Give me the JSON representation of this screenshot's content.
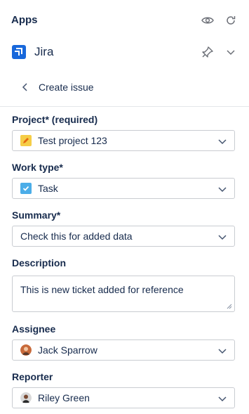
{
  "header": {
    "title": "Apps",
    "icons": [
      "eye-icon",
      "refresh-icon"
    ]
  },
  "app": {
    "name": "Jira",
    "icons": [
      "pin-icon",
      "chevron-down-icon"
    ]
  },
  "breadcrumb": {
    "label": "Create issue"
  },
  "form": {
    "project": {
      "label": "Project* (required)",
      "value": "Test project 123",
      "icon": "pencil-icon",
      "icon_color": "#f5cd47"
    },
    "work_type": {
      "label": "Work type*",
      "value": "Task",
      "icon": "checkbox-icon",
      "icon_color": "#4bade8"
    },
    "summary": {
      "label": "Summary*",
      "value": "Check this for added data"
    },
    "description": {
      "label": "Description",
      "value": "This is new ticket added for reference"
    },
    "assignee": {
      "label": "Assignee",
      "value": "Jack Sparrow"
    },
    "reporter": {
      "label": "Reporter",
      "value": "Riley Green"
    }
  },
  "colors": {
    "brand": "#1868db",
    "text": "#172b4d",
    "border": "#c9ccd1"
  }
}
